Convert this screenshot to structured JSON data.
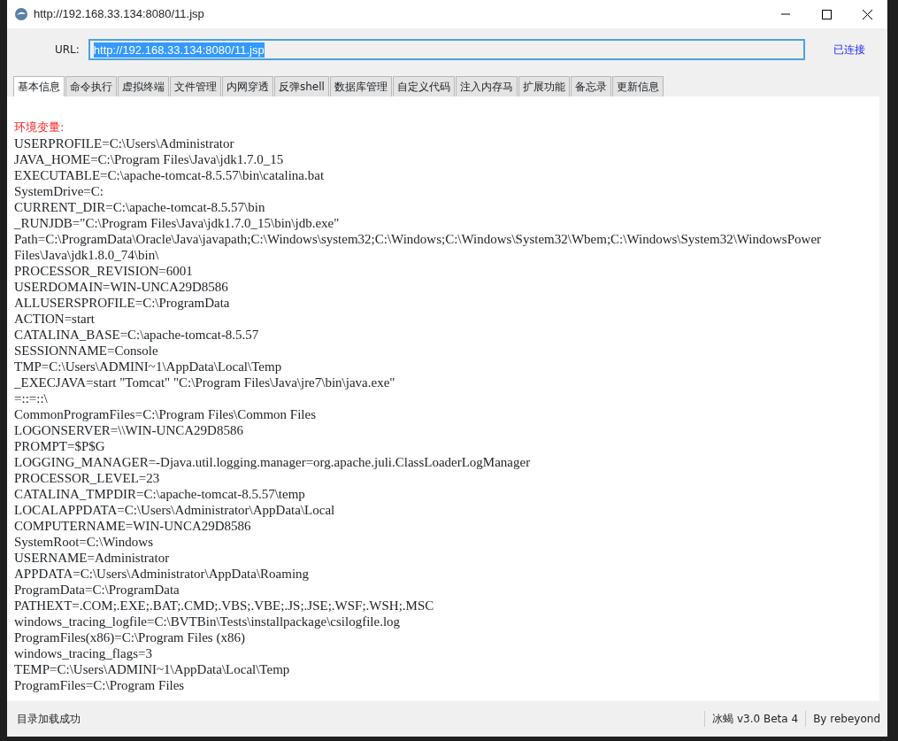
{
  "window": {
    "title": "http://192.168.33.134:8080/11.jsp"
  },
  "url_bar": {
    "label": "URL:",
    "value": "http://192.168.33.134:8080/11.jsp",
    "status": "已连接"
  },
  "tabs": [
    {
      "label": "基本信息",
      "selected": true
    },
    {
      "label": "命令执行",
      "selected": false
    },
    {
      "label": "虚拟终端",
      "selected": false
    },
    {
      "label": "文件管理",
      "selected": false
    },
    {
      "label": "内网穿透",
      "selected": false
    },
    {
      "label": "反弹shell",
      "selected": false
    },
    {
      "label": "数据库管理",
      "selected": false
    },
    {
      "label": "自定义代码",
      "selected": false
    },
    {
      "label": "注入内存马",
      "selected": false
    },
    {
      "label": "扩展功能",
      "selected": false
    },
    {
      "label": "备忘录",
      "selected": false
    },
    {
      "label": "更新信息",
      "selected": false
    }
  ],
  "content": {
    "heading": "环境变量:",
    "lines": [
      "USERPROFILE=C:\\Users\\Administrator",
      "JAVA_HOME=C:\\Program Files\\Java\\jdk1.7.0_15",
      "EXECUTABLE=C:\\apache-tomcat-8.5.57\\bin\\catalina.bat",
      "SystemDrive=C:",
      "CURRENT_DIR=C:\\apache-tomcat-8.5.57\\bin",
      "_RUNJDB=\"C:\\Program Files\\Java\\jdk1.7.0_15\\bin\\jdb.exe\"",
      "Path=C:\\ProgramData\\Oracle\\Java\\javapath;C:\\Windows\\system32;C:\\Windows;C:\\Windows\\System32\\Wbem;C:\\Windows\\System32\\WindowsPower",
      "Files\\Java\\jdk1.8.0_74\\bin\\",
      "PROCESSOR_REVISION=6001",
      "USERDOMAIN=WIN-UNCA29D8586",
      "ALLUSERSPROFILE=C:\\ProgramData",
      "ACTION=start",
      "CATALINA_BASE=C:\\apache-tomcat-8.5.57",
      "SESSIONNAME=Console",
      "TMP=C:\\Users\\ADMINI~1\\AppData\\Local\\Temp",
      "_EXECJAVA=start \"Tomcat\" \"C:\\Program Files\\Java\\jre7\\bin\\java.exe\"",
      "=::=::\\",
      "CommonProgramFiles=C:\\Program Files\\Common Files",
      "LOGONSERVER=\\\\WIN-UNCA29D8586",
      "PROMPT=$P$G",
      "LOGGING_MANAGER=-Djava.util.logging.manager=org.apache.juli.ClassLoaderLogManager",
      "PROCESSOR_LEVEL=23",
      "CATALINA_TMPDIR=C:\\apache-tomcat-8.5.57\\temp",
      "LOCALAPPDATA=C:\\Users\\Administrator\\AppData\\Local",
      "COMPUTERNAME=WIN-UNCA29D8586",
      "SystemRoot=C:\\Windows",
      "USERNAME=Administrator",
      "APPDATA=C:\\Users\\Administrator\\AppData\\Roaming",
      "ProgramData=C:\\ProgramData",
      "PATHEXT=.COM;.EXE;.BAT;.CMD;.VBS;.VBE;.JS;.JSE;.WSF;.WSH;.MSC",
      "windows_tracing_logfile=C:\\BVTBin\\Tests\\installpackage\\csilogfile.log",
      "ProgramFiles(x86)=C:\\Program Files (x86)",
      "windows_tracing_flags=3",
      "TEMP=C:\\Users\\ADMINI~1\\AppData\\Local\\Temp",
      "ProgramFiles=C:\\Program Files"
    ]
  },
  "status_bar": {
    "message": "目录加载成功",
    "version": "冰蝎 v3.0 Beta 4",
    "author": "By rebeyond"
  }
}
